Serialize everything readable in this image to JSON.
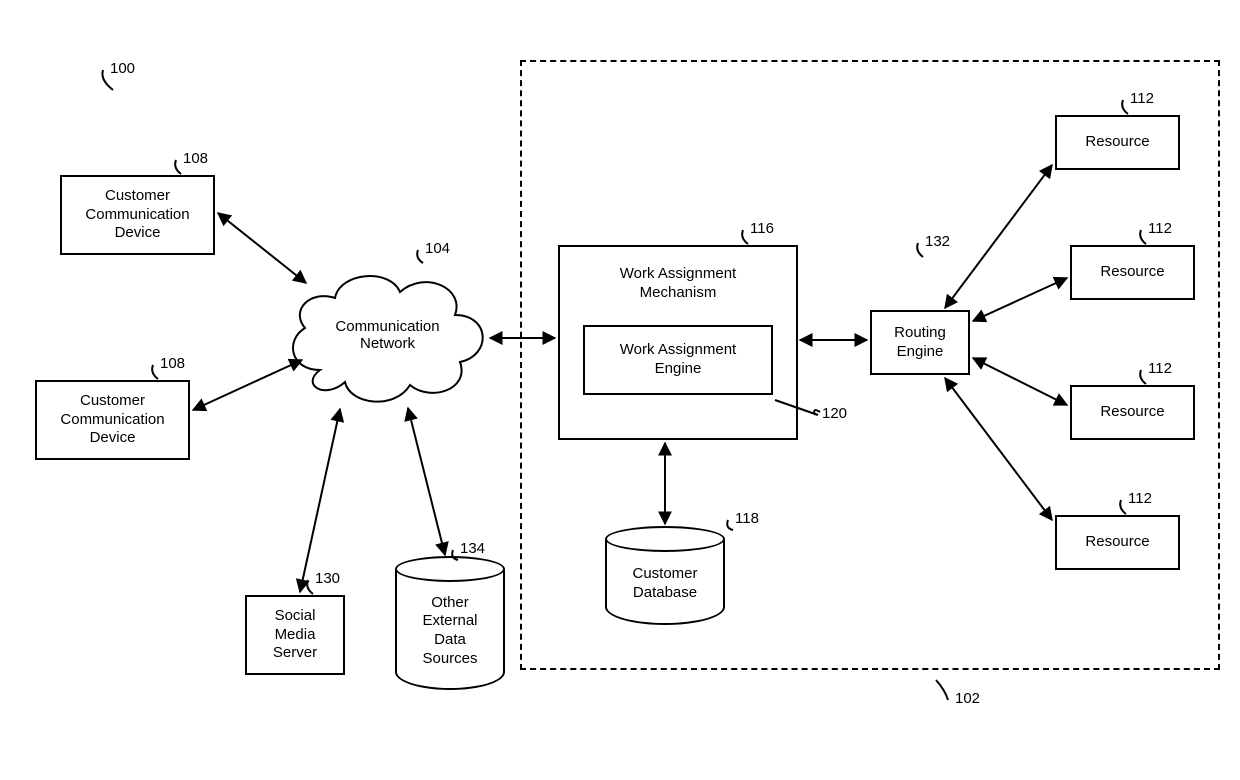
{
  "refs": {
    "system": "100",
    "container": "102",
    "network": "104",
    "custdev": "108",
    "resource": "112",
    "wam": "116",
    "db": "118",
    "wae": "120",
    "social": "130",
    "routing": "132",
    "other": "134"
  },
  "labels": {
    "custdev": "Customer\nCommunication\nDevice",
    "network": "Communication\nNetwork",
    "social": "Social\nMedia\nServer",
    "other": "Other\nExternal\nData\nSources",
    "wam": "Work Assignment\nMechanism",
    "wae": "Work Assignment\nEngine",
    "db": "Customer\nDatabase",
    "routing": "Routing\nEngine",
    "resource": "Resource"
  }
}
